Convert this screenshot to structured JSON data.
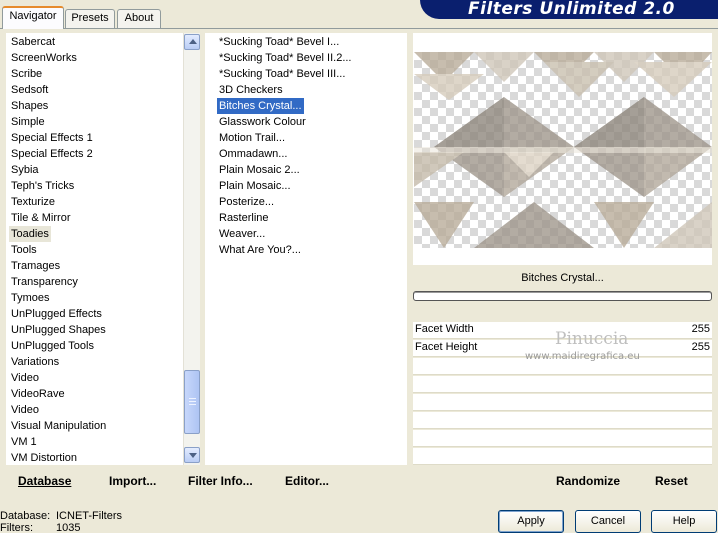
{
  "tabs": [
    {
      "label": "Navigator",
      "active": true
    },
    {
      "label": "Presets",
      "active": false
    },
    {
      "label": "About",
      "active": false
    }
  ],
  "banner_title": "Filters Unlimited 2.0",
  "categories": [
    "Sabercat",
    "ScreenWorks",
    "Scribe",
    "Sedsoft",
    "Shapes",
    "Simple",
    "Special Effects 1",
    "Special Effects 2",
    "Sybia",
    "Teph's Tricks",
    "Texturize",
    "Tile & Mirror",
    "Toadies",
    "Tools",
    "Tramages",
    "Transparency",
    "Tymoes",
    "UnPlugged Effects",
    "UnPlugged Shapes",
    "UnPlugged Tools",
    "Variations",
    "Video",
    "VideoRave",
    "Video",
    "Visual Manipulation",
    "VM 1",
    "VM Distortion"
  ],
  "selected_category": "Toadies",
  "filters": [
    "*Sucking Toad*  Bevel I...",
    "*Sucking Toad*  Bevel II.2...",
    "*Sucking Toad*  Bevel III...",
    "3D Checkers",
    "Bitches Crystal...",
    "Glasswork Colour",
    "Motion Trail...",
    "Ommadawn...",
    "Plain Mosaic 2...",
    "Plain Mosaic...",
    "Posterize...",
    "Rasterline",
    "Weaver...",
    "What Are You?..."
  ],
  "selected_filter": "Bitches Crystal...",
  "filter_name_display": "Bitches Crystal...",
  "params": [
    {
      "label": "Facet Width",
      "value": "255"
    },
    {
      "label": "Facet Height",
      "value": "255"
    }
  ],
  "watermark": {
    "line1": "Pinuccia",
    "line2": "www.maidiregrafica.eu"
  },
  "bottom_buttons": {
    "database": "Database",
    "import": "Import...",
    "filter_info": "Filter Info...",
    "editor": "Editor...",
    "randomize": "Randomize",
    "reset": "Reset"
  },
  "status": {
    "database_label": "Database:",
    "database_value": "ICNET-Filters",
    "filters_label": "Filters:",
    "filters_value": "1035"
  },
  "dialog_buttons": {
    "apply": "Apply",
    "cancel": "Cancel",
    "help": "Help"
  },
  "colors": {
    "accent_tab": "#e68b2c",
    "selection": "#316ac5",
    "banner": "#0a1f6e",
    "dialog_bg": "#ece9d8"
  }
}
